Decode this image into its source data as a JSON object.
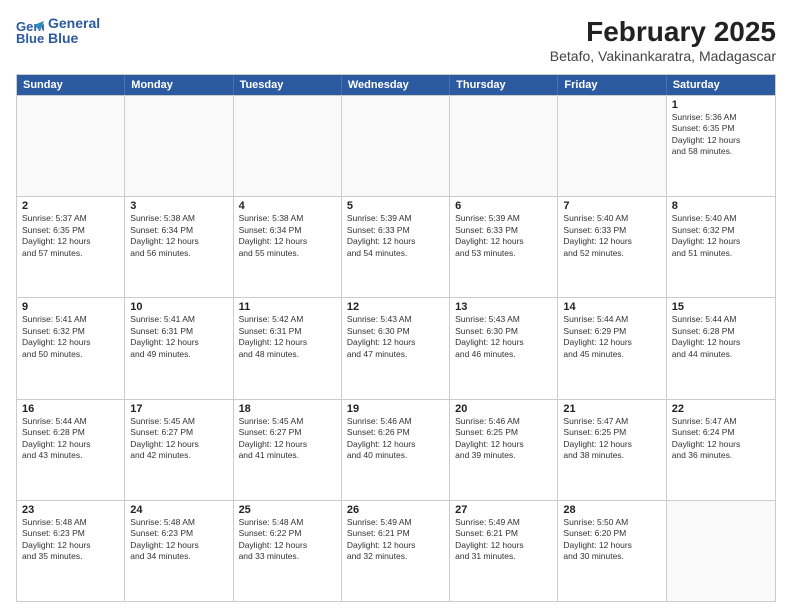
{
  "header": {
    "logo_line1": "General",
    "logo_line2": "Blue",
    "title": "February 2025",
    "subtitle": "Betafo, Vakinankaratra, Madagascar"
  },
  "days": [
    "Sunday",
    "Monday",
    "Tuesday",
    "Wednesday",
    "Thursday",
    "Friday",
    "Saturday"
  ],
  "weeks": [
    [
      {
        "day": "",
        "text": ""
      },
      {
        "day": "",
        "text": ""
      },
      {
        "day": "",
        "text": ""
      },
      {
        "day": "",
        "text": ""
      },
      {
        "day": "",
        "text": ""
      },
      {
        "day": "",
        "text": ""
      },
      {
        "day": "1",
        "text": "Sunrise: 5:36 AM\nSunset: 6:35 PM\nDaylight: 12 hours\nand 58 minutes."
      }
    ],
    [
      {
        "day": "2",
        "text": "Sunrise: 5:37 AM\nSunset: 6:35 PM\nDaylight: 12 hours\nand 57 minutes."
      },
      {
        "day": "3",
        "text": "Sunrise: 5:38 AM\nSunset: 6:34 PM\nDaylight: 12 hours\nand 56 minutes."
      },
      {
        "day": "4",
        "text": "Sunrise: 5:38 AM\nSunset: 6:34 PM\nDaylight: 12 hours\nand 55 minutes."
      },
      {
        "day": "5",
        "text": "Sunrise: 5:39 AM\nSunset: 6:33 PM\nDaylight: 12 hours\nand 54 minutes."
      },
      {
        "day": "6",
        "text": "Sunrise: 5:39 AM\nSunset: 6:33 PM\nDaylight: 12 hours\nand 53 minutes."
      },
      {
        "day": "7",
        "text": "Sunrise: 5:40 AM\nSunset: 6:33 PM\nDaylight: 12 hours\nand 52 minutes."
      },
      {
        "day": "8",
        "text": "Sunrise: 5:40 AM\nSunset: 6:32 PM\nDaylight: 12 hours\nand 51 minutes."
      }
    ],
    [
      {
        "day": "9",
        "text": "Sunrise: 5:41 AM\nSunset: 6:32 PM\nDaylight: 12 hours\nand 50 minutes."
      },
      {
        "day": "10",
        "text": "Sunrise: 5:41 AM\nSunset: 6:31 PM\nDaylight: 12 hours\nand 49 minutes."
      },
      {
        "day": "11",
        "text": "Sunrise: 5:42 AM\nSunset: 6:31 PM\nDaylight: 12 hours\nand 48 minutes."
      },
      {
        "day": "12",
        "text": "Sunrise: 5:43 AM\nSunset: 6:30 PM\nDaylight: 12 hours\nand 47 minutes."
      },
      {
        "day": "13",
        "text": "Sunrise: 5:43 AM\nSunset: 6:30 PM\nDaylight: 12 hours\nand 46 minutes."
      },
      {
        "day": "14",
        "text": "Sunrise: 5:44 AM\nSunset: 6:29 PM\nDaylight: 12 hours\nand 45 minutes."
      },
      {
        "day": "15",
        "text": "Sunrise: 5:44 AM\nSunset: 6:28 PM\nDaylight: 12 hours\nand 44 minutes."
      }
    ],
    [
      {
        "day": "16",
        "text": "Sunrise: 5:44 AM\nSunset: 6:28 PM\nDaylight: 12 hours\nand 43 minutes."
      },
      {
        "day": "17",
        "text": "Sunrise: 5:45 AM\nSunset: 6:27 PM\nDaylight: 12 hours\nand 42 minutes."
      },
      {
        "day": "18",
        "text": "Sunrise: 5:45 AM\nSunset: 6:27 PM\nDaylight: 12 hours\nand 41 minutes."
      },
      {
        "day": "19",
        "text": "Sunrise: 5:46 AM\nSunset: 6:26 PM\nDaylight: 12 hours\nand 40 minutes."
      },
      {
        "day": "20",
        "text": "Sunrise: 5:46 AM\nSunset: 6:25 PM\nDaylight: 12 hours\nand 39 minutes."
      },
      {
        "day": "21",
        "text": "Sunrise: 5:47 AM\nSunset: 6:25 PM\nDaylight: 12 hours\nand 38 minutes."
      },
      {
        "day": "22",
        "text": "Sunrise: 5:47 AM\nSunset: 6:24 PM\nDaylight: 12 hours\nand 36 minutes."
      }
    ],
    [
      {
        "day": "23",
        "text": "Sunrise: 5:48 AM\nSunset: 6:23 PM\nDaylight: 12 hours\nand 35 minutes."
      },
      {
        "day": "24",
        "text": "Sunrise: 5:48 AM\nSunset: 6:23 PM\nDaylight: 12 hours\nand 34 minutes."
      },
      {
        "day": "25",
        "text": "Sunrise: 5:48 AM\nSunset: 6:22 PM\nDaylight: 12 hours\nand 33 minutes."
      },
      {
        "day": "26",
        "text": "Sunrise: 5:49 AM\nSunset: 6:21 PM\nDaylight: 12 hours\nand 32 minutes."
      },
      {
        "day": "27",
        "text": "Sunrise: 5:49 AM\nSunset: 6:21 PM\nDaylight: 12 hours\nand 31 minutes."
      },
      {
        "day": "28",
        "text": "Sunrise: 5:50 AM\nSunset: 6:20 PM\nDaylight: 12 hours\nand 30 minutes."
      },
      {
        "day": "",
        "text": ""
      }
    ]
  ]
}
